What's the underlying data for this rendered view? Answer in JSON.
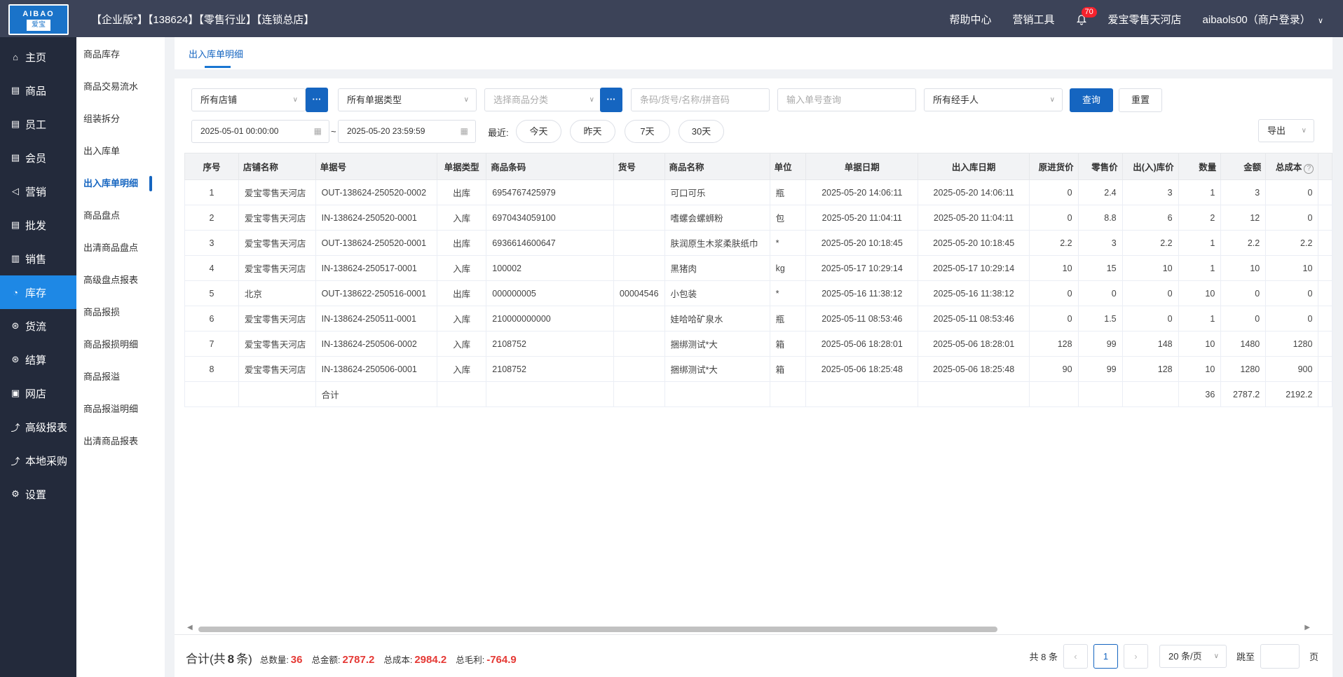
{
  "header": {
    "logo_top": "AIBAO",
    "logo_bottom": "爱宝",
    "brand": "【企业版*】【138624】【零售行业】【连锁总店】",
    "help": "帮助中心",
    "marketing_tools": "营销工具",
    "notify_count": "70",
    "store": "爱宝零售天河店",
    "user": "aibaols00（商户登录）"
  },
  "sidebar": {
    "items": [
      {
        "label": "主页",
        "icon": "home-icon",
        "glyph": "⌂"
      },
      {
        "label": "商品",
        "icon": "goods-icon",
        "glyph": "▤"
      },
      {
        "label": "员工",
        "icon": "staff-icon",
        "glyph": "▤"
      },
      {
        "label": "会员",
        "icon": "member-icon",
        "glyph": "▤"
      },
      {
        "label": "营销",
        "icon": "marketing-icon",
        "glyph": "◁"
      },
      {
        "label": "批发",
        "icon": "wholesale-icon",
        "glyph": "▤"
      },
      {
        "label": "销售",
        "icon": "sales-icon",
        "glyph": "▥"
      },
      {
        "label": "库存",
        "icon": "inventory-icon",
        "glyph": "◔"
      },
      {
        "label": "货流",
        "icon": "logistics-icon",
        "glyph": "⊛"
      },
      {
        "label": "结算",
        "icon": "settlement-icon",
        "glyph": "⊛"
      },
      {
        "label": "网店",
        "icon": "webstore-icon",
        "glyph": "▣"
      },
      {
        "label": "高级报表",
        "icon": "report-icon",
        "glyph": "⤴"
      },
      {
        "label": "本地采购",
        "icon": "purchase-icon",
        "glyph": "⤴"
      },
      {
        "label": "设置",
        "icon": "settings-icon",
        "glyph": "⚙"
      }
    ],
    "active_index": 7
  },
  "subnav": {
    "items": [
      "商品库存",
      "商品交易流水",
      "组装拆分",
      "出入库单",
      "出入库单明细",
      "商品盘点",
      "出清商品盘点",
      "高级盘点报表",
      "商品报损",
      "商品报损明细",
      "商品报溢",
      "商品报溢明细",
      "出清商品报表"
    ],
    "active_index": 4
  },
  "tabs": {
    "active": "出入库单明细"
  },
  "filters": {
    "store": "所有店铺",
    "doc_type": "所有单据类型",
    "category_placeholder": "选择商品分类",
    "code_placeholder": "条码/货号/名称/拼音码",
    "doc_no_placeholder": "输入单号查询",
    "handler": "所有经手人",
    "query": "查询",
    "reset": "重置",
    "date_from": "2025-05-01 00:00:00",
    "date_sep": "~",
    "date_to": "2025-05-20 23:59:59",
    "recent_label": "最近:",
    "today": "今天",
    "yesterday": "昨天",
    "d7": "7天",
    "d30": "30天",
    "export": "导出",
    "dots": "···"
  },
  "table": {
    "columns": [
      "序号",
      "店铺名称",
      "单据号",
      "单据类型",
      "商品条码",
      "货号",
      "商品名称",
      "单位",
      "单据日期",
      "出入库日期",
      "原进货价",
      "零售价",
      "出(入)库价",
      "数量",
      "金额",
      "总成本"
    ],
    "rows": [
      [
        "1",
        "爱宝零售天河店",
        "OUT-138624-250520-0002",
        "出库",
        "6954767425979",
        "",
        "可口可乐",
        "瓶",
        "2025-05-20 14:06:11",
        "2025-05-20 14:06:11",
        "0",
        "2.4",
        "3",
        "1",
        "3",
        "0"
      ],
      [
        "2",
        "爱宝零售天河店",
        "IN-138624-250520-0001",
        "入库",
        "6970434059100",
        "",
        "嗜螺会螺蛳粉",
        "包",
        "2025-05-20 11:04:11",
        "2025-05-20 11:04:11",
        "0",
        "8.8",
        "6",
        "2",
        "12",
        "0"
      ],
      [
        "3",
        "爱宝零售天河店",
        "OUT-138624-250520-0001",
        "出库",
        "6936614600647",
        "",
        "肤润原生木浆柔肤纸巾",
        "*",
        "2025-05-20 10:18:45",
        "2025-05-20 10:18:45",
        "2.2",
        "3",
        "2.2",
        "1",
        "2.2",
        "2.2"
      ],
      [
        "4",
        "爱宝零售天河店",
        "IN-138624-250517-0001",
        "入库",
        "100002",
        "",
        "黑猪肉",
        "kg",
        "2025-05-17 10:29:14",
        "2025-05-17 10:29:14",
        "10",
        "15",
        "10",
        "1",
        "10",
        "10"
      ],
      [
        "5",
        "北京",
        "OUT-138622-250516-0001",
        "出库",
        "000000005",
        "00004546",
        "小包装",
        "*",
        "2025-05-16 11:38:12",
        "2025-05-16 11:38:12",
        "0",
        "0",
        "0",
        "10",
        "0",
        "0"
      ],
      [
        "6",
        "爱宝零售天河店",
        "IN-138624-250511-0001",
        "入库",
        "210000000000",
        "",
        "娃哈哈矿泉水",
        "瓶",
        "2025-05-11 08:53:46",
        "2025-05-11 08:53:46",
        "0",
        "1.5",
        "0",
        "1",
        "0",
        "0"
      ],
      [
        "7",
        "爱宝零售天河店",
        "IN-138624-250506-0002",
        "入库",
        "2108752",
        "",
        "捆绑测试*大",
        "箱",
        "2025-05-06 18:28:01",
        "2025-05-06 18:28:01",
        "128",
        "99",
        "148",
        "10",
        "1480",
        "1280"
      ],
      [
        "8",
        "爱宝零售天河店",
        "IN-138624-250506-0001",
        "入库",
        "2108752",
        "",
        "捆绑测试*大",
        "箱",
        "2025-05-06 18:25:48",
        "2025-05-06 18:25:48",
        "90",
        "99",
        "128",
        "10",
        "1280",
        "900"
      ]
    ],
    "total_row": [
      "",
      "",
      "合计",
      "",
      "",
      "",
      "",
      "",
      "",
      "",
      "",
      "",
      "",
      "36",
      "2787.2",
      "2192.2"
    ]
  },
  "footer": {
    "sum_prefix": "合计(共",
    "count": "8",
    "sum_suffix": "条)",
    "qty_label": "总数量:",
    "qty": "36",
    "amount_label": "总金额:",
    "amount": "2787.2",
    "cost_label": "总成本:",
    "cost": "2984.2",
    "profit_label": "总毛利:",
    "profit": "-764.9",
    "total_text": "共 8 条",
    "page": "1",
    "page_size": "20 条/页",
    "jump_label": "跳至",
    "page_unit": "页"
  }
}
